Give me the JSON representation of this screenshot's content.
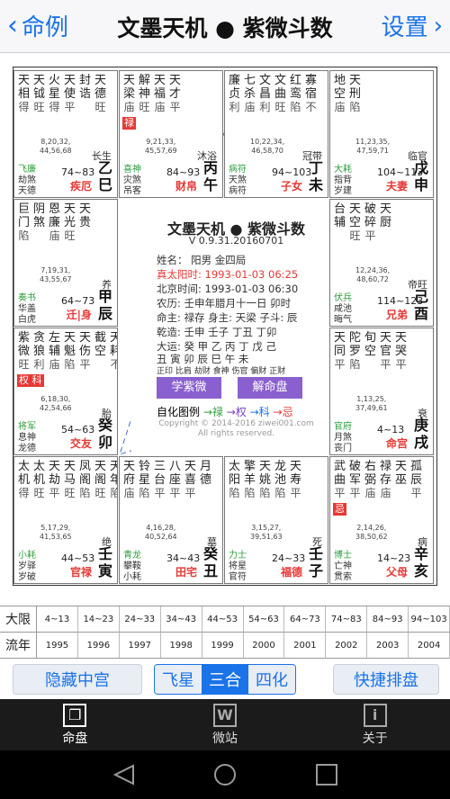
{
  "nav": {
    "back_label": "命例",
    "title": "文墨天机 ● 紫微斗数",
    "settings_label": "设置"
  },
  "cells": [
    {
      "stars": [
        [
          "天",
          "相",
          "得"
        ],
        [
          "天",
          "钺",
          "旺"
        ],
        [
          "火",
          "星",
          "得"
        ],
        [
          "天",
          "使",
          "平"
        ],
        [
          "封",
          "诰",
          ""
        ],
        [
          "天",
          "德",
          "旺"
        ]
      ],
      "hua": "",
      "ages": [
        "8,20,32,",
        "44,56,68"
      ],
      "stage": "长生",
      "gods": [
        "飞廉",
        "劫煞",
        "天德"
      ],
      "range": "74~83",
      "gz": [
        "乙",
        "巳"
      ],
      "palace": "疾厄"
    },
    {
      "stars": [
        [
          "天",
          "梁",
          "庙"
        ],
        [
          "解",
          "神",
          "旺"
        ],
        [
          "天",
          "福",
          "庙"
        ],
        [
          "天",
          "才",
          "平"
        ]
      ],
      "hua": "禄",
      "ages": [
        "9,21,33,",
        "45,57,69"
      ],
      "stage": "沐浴",
      "gods": [
        "喜神",
        "灾煞",
        "吊客"
      ],
      "range": "84~93",
      "gz": [
        "丙",
        "午"
      ],
      "palace": "财帛"
    },
    {
      "stars": [
        [
          "廉",
          "贞",
          "利"
        ],
        [
          "七",
          "杀",
          "庙"
        ],
        [
          "文",
          "昌",
          "利"
        ],
        [
          "文",
          "曲",
          "旺"
        ],
        [
          "红",
          "鸾",
          "陷"
        ],
        [
          "寡",
          "宿",
          "不"
        ]
      ],
      "hua": "",
      "ages": [
        "10,22,34,",
        "46,58,70"
      ],
      "stage": "冠带",
      "gods": [
        "病符",
        "天煞",
        "病符"
      ],
      "range": "94~103",
      "gz": [
        "丁",
        "未"
      ],
      "palace": "子女"
    },
    {
      "stars": [
        [
          "地",
          "空",
          "庙"
        ],
        [
          "天",
          "刑",
          "陷"
        ]
      ],
      "hua": "",
      "ages": [
        "11,23,35,",
        "47,59,71"
      ],
      "stage": "临官",
      "gods": [
        "大耗",
        "指背",
        "岁建"
      ],
      "range": "104~113",
      "gz": [
        "戊",
        "申"
      ],
      "palace": "夫妻"
    },
    {
      "stars": [
        [
          "巨",
          "门",
          "陷"
        ],
        [
          "阴",
          "煞",
          ""
        ],
        [
          "恩",
          "廉",
          "庙"
        ],
        [
          "天",
          "光",
          "旺"
        ],
        [
          "天",
          "贵",
          ""
        ]
      ],
      "hua": "",
      "ages": [
        "7,19,31,",
        "43,55,67"
      ],
      "stage": "养",
      "gods": [
        "奏书",
        "华盖",
        "白虎"
      ],
      "range": "64~73",
      "gz": [
        "甲",
        "辰"
      ],
      "palace": "迁|身"
    },
    {
      "stars": [
        [
          "台",
          "辅",
          ""
        ],
        [
          "天",
          "空",
          "旺"
        ],
        [
          "破",
          "碎",
          "平"
        ],
        [
          "天",
          "厨",
          ""
        ]
      ],
      "hua": "",
      "ages": [
        "12,24,36,",
        "48,60,72"
      ],
      "stage": "帝旺",
      "gods": [
        "伏兵",
        "咸池",
        "晦气"
      ],
      "range": "114~123",
      "gz": [
        "己",
        "酉"
      ],
      "palace": "兄弟"
    },
    {
      "stars": [
        [
          "紫",
          "微",
          "旺"
        ],
        [
          "贪",
          "狼",
          "利"
        ],
        [
          "左",
          "辅",
          "庙"
        ],
        [
          "天",
          "魁",
          "陷"
        ],
        [
          "天",
          "伤",
          "平"
        ],
        [
          "截",
          "空",
          ""
        ],
        [
          "天",
          "耗",
          "不"
        ]
      ],
      "hua": "权 科",
      "ages": [
        "6,18,30,",
        "42,54,66"
      ],
      "stage": "胎",
      "gods": [
        "将军",
        "息神",
        "龙德"
      ],
      "range": "54~63",
      "gz": [
        "癸",
        "卯"
      ],
      "palace": "交友"
    },
    {
      "stars": [
        [
          "天",
          "同",
          "平"
        ],
        [
          "陀",
          "罗",
          "陷"
        ],
        [
          "旬",
          "空",
          ""
        ],
        [
          "天",
          "官",
          "平"
        ],
        [
          "天",
          "哭",
          "平"
        ]
      ],
      "hua": "",
      "ages": [
        "1,13,25,",
        "37,49,61"
      ],
      "stage": "衰",
      "gods": [
        "官府",
        "月煞",
        "丧门"
      ],
      "range": "4~13",
      "gz": [
        "庚",
        "戌"
      ],
      "palace": "命宫"
    },
    {
      "stars": [
        [
          "太",
          "机",
          "得"
        ],
        [
          "太",
          "机",
          "旺"
        ],
        [
          "天",
          "劫",
          "平"
        ],
        [
          "天",
          "马",
          "旺"
        ],
        [
          "凤",
          "阁",
          "陷"
        ],
        [
          "天",
          "阁",
          "旺"
        ],
        [
          "天",
          "年",
          "陷"
        ]
      ],
      "hua": "",
      "ages": [
        "5,17,29,",
        "41,53,65"
      ],
      "stage": "绝",
      "gods": [
        "小耗",
        "岁驿",
        "岁破"
      ],
      "range": "44~53",
      "gz": [
        "壬",
        "寅"
      ],
      "palace": "官禄"
    },
    {
      "stars": [
        [
          "天",
          "府",
          "庙"
        ],
        [
          "铃",
          "星",
          "陷"
        ],
        [
          "三",
          "台",
          "平"
        ],
        [
          "八",
          "座",
          "平"
        ],
        [
          "天",
          "喜",
          "平"
        ],
        [
          "月",
          "德",
          ""
        ]
      ],
      "hua": "",
      "ages": [
        "4,16,28,",
        "40,52,64"
      ],
      "stage": "墓",
      "gods": [
        "青龙",
        "攀鞍",
        "小耗"
      ],
      "range": "34~43",
      "gz": [
        "癸",
        "丑"
      ],
      "palace": "田宅"
    },
    {
      "stars": [
        [
          "太",
          "阳",
          "陷"
        ],
        [
          "擎",
          "羊",
          "陷"
        ],
        [
          "天",
          "姚",
          "陷"
        ],
        [
          "龙",
          "池",
          "陷"
        ],
        [
          "天",
          "寿",
          "平"
        ]
      ],
      "hua": "",
      "ages": [
        "3,15,27,",
        "39,51,63"
      ],
      "stage": "死",
      "gods": [
        "力士",
        "将星",
        "官符"
      ],
      "range": "24~33",
      "gz": [
        "壬",
        "子"
      ],
      "palace": "福德"
    },
    {
      "stars": [
        [
          "武",
          "曲",
          "平"
        ],
        [
          "破",
          "军",
          "平"
        ],
        [
          "右",
          "弼",
          "庙"
        ],
        [
          "禄",
          "存",
          "庙"
        ],
        [
          "天",
          "巫",
          ""
        ],
        [
          "孤",
          "辰",
          "平"
        ]
      ],
      "hua": "忌",
      "ages": [
        "2,14,26,",
        "38,50,62"
      ],
      "stage": "病",
      "gods": [
        "博士",
        "亡神",
        "贯索"
      ],
      "range": "14~23",
      "gz": [
        "辛",
        "亥"
      ],
      "palace": "父母"
    }
  ],
  "center": {
    "title": "文墨天机 ● 紫微斗数",
    "version": "V 0.9.31.20160701",
    "lines": [
      "姓名：       阳男 金四局",
      "真太阳时: 1993-01-03  06:25",
      "北京时间: 1993-01-03  06:30",
      "农历: 壬申年腊月十一日 卯时",
      "命主: 禄存 身主: 天梁 子斗: 辰",
      "乾造: 壬申  壬子  丁丑  丁卯",
      "大运: 癸  甲  乙  丙  丁  戊  己",
      "         丑  寅  卯  辰  巳  午  未",
      "正印 比肩 劫财 食神 伤官 偏财 正财"
    ],
    "btn_study": "学紫微",
    "btn_explain": "解命盘",
    "legend": {
      "prefix": "自化图例",
      "lu": "→禄",
      "quan": "→权",
      "ke": "→科",
      "ji": "→忌"
    },
    "copyright": "Copyright © 2014-2016 ziwei001.com",
    "rights": "All rights reserved."
  },
  "table": {
    "row1_label": "大限",
    "row1": [
      "4~13",
      "14~23",
      "24~33",
      "34~43",
      "44~53",
      "54~63",
      "64~73",
      "74~83",
      "84~93",
      "94~103"
    ],
    "row2_label": "流年",
    "row2": [
      "1995",
      "1996",
      "1997",
      "1998",
      "1999",
      "2000",
      "2001",
      "2002",
      "2003",
      "2004"
    ]
  },
  "actions": {
    "hide": "隐藏中宫",
    "flying": "飞星",
    "sanhe": "三合",
    "sihua": "四化",
    "quick": "快捷排盘"
  },
  "tabs": {
    "mingpan": "命盘",
    "weizhan": "微站",
    "guanyu": "关于"
  }
}
